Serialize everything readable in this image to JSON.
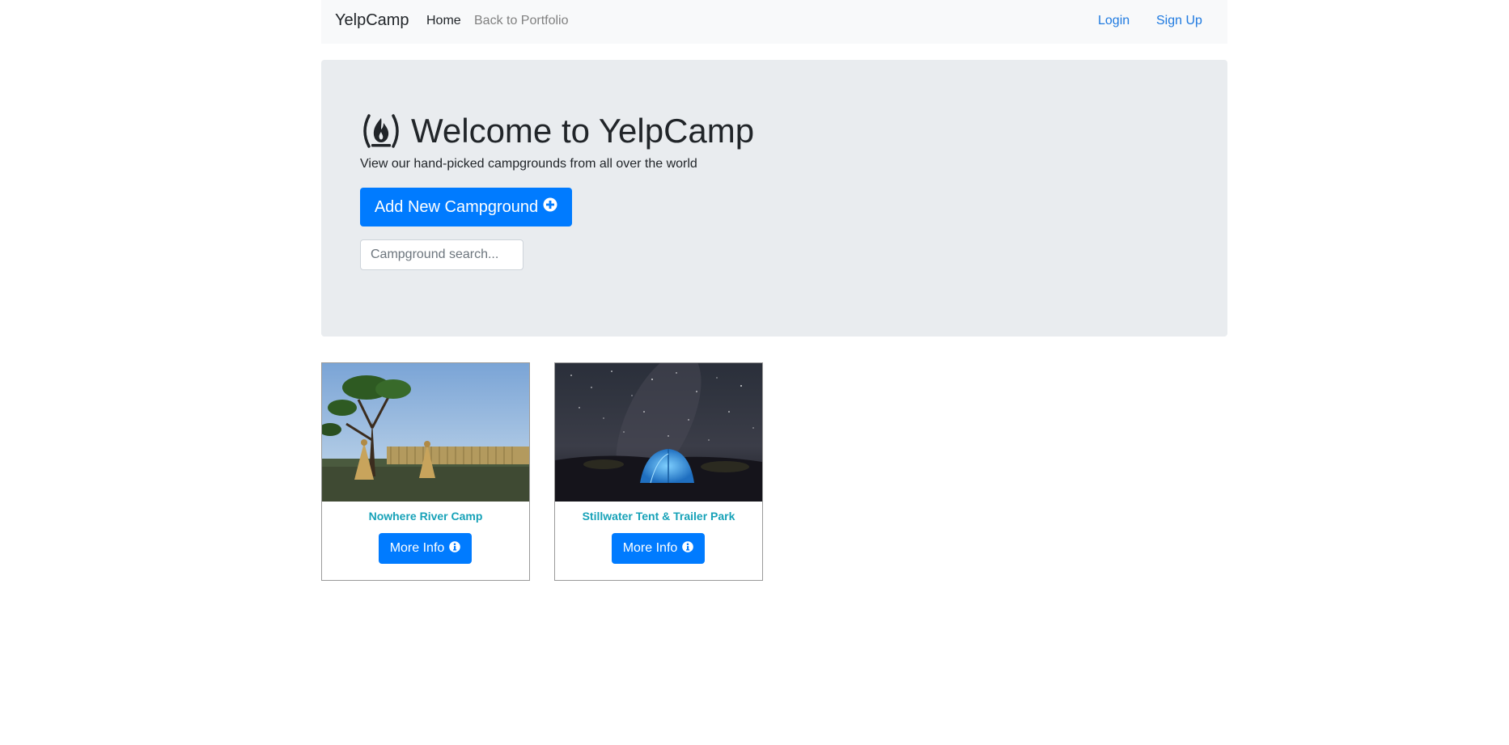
{
  "navbar": {
    "brand": "YelpCamp",
    "home": "Home",
    "portfolio": "Back to Portfolio",
    "login": "Login",
    "signup": "Sign Up"
  },
  "jumbotron": {
    "title": "Welcome to YelpCamp",
    "subtitle": "View our hand-picked campgrounds from all over the world",
    "add_button": "Add New Campground",
    "search_placeholder": "Campground search..."
  },
  "campgrounds": [
    {
      "name": "Nowhere River Camp",
      "button": "More Info"
    },
    {
      "name": "Stillwater Tent & Trailer Park",
      "button": "More Info"
    }
  ],
  "colors": {
    "primary": "#007bff",
    "title_teal": "#17a2b8",
    "jumbotron_bg": "#e9ecef",
    "navbar_bg": "#f8f9fa",
    "link_blue": "#1f7ae0"
  },
  "icons": [
    "campfire-icon",
    "plus-circle-icon",
    "info-circle-icon"
  ]
}
